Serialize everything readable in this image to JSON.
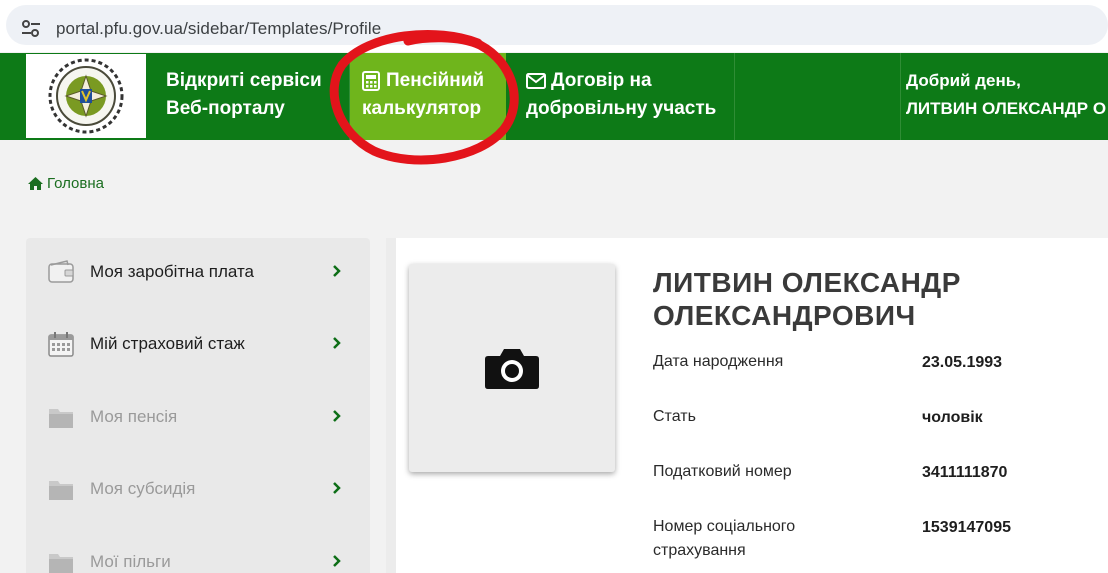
{
  "address_bar": {
    "url": "portal.pfu.gov.ua/sidebar/Templates/Profile"
  },
  "header": {
    "nav": [
      {
        "line1": "Відкриті сервіси",
        "line2": "Веб-порталу"
      },
      {
        "line1": "Пенсійний",
        "line2": "калькулятор"
      },
      {
        "line1": "Договір на",
        "line2": "добровільну участь"
      }
    ],
    "greeting": "Добрий день,",
    "user_name": "ЛИТВИН ОЛЕКСАНДР О"
  },
  "breadcrumb": {
    "home": "Головна"
  },
  "sidebar": {
    "items": [
      {
        "label": "Моя заробітна плата",
        "icon": "wallet-icon"
      },
      {
        "label": "Мій страховий стаж",
        "icon": "calendar-icon"
      },
      {
        "label": "Моя пенсія",
        "icon": "folder-icon"
      },
      {
        "label": "Моя субсидія",
        "icon": "folder-icon"
      },
      {
        "label": "Мої пільги",
        "icon": "folder-icon"
      }
    ]
  },
  "profile": {
    "name_line1": "ЛИТВИН ОЛЕКСАНДР",
    "name_line2": "ОЛЕКСАНДРОВИЧ",
    "fields": [
      {
        "label": "Дата народження",
        "value": "23.05.1993"
      },
      {
        "label": "Стать",
        "value": "чоловік"
      },
      {
        "label": "Податковий номер",
        "value": "3411111870"
      },
      {
        "label_line1": "Номер соціального",
        "label_line2": "страхування",
        "value": "1539147095"
      }
    ]
  },
  "colors": {
    "header_green": "#0d7a17",
    "active_tab": "#6fb51c",
    "annotation_red": "#e3141b"
  }
}
